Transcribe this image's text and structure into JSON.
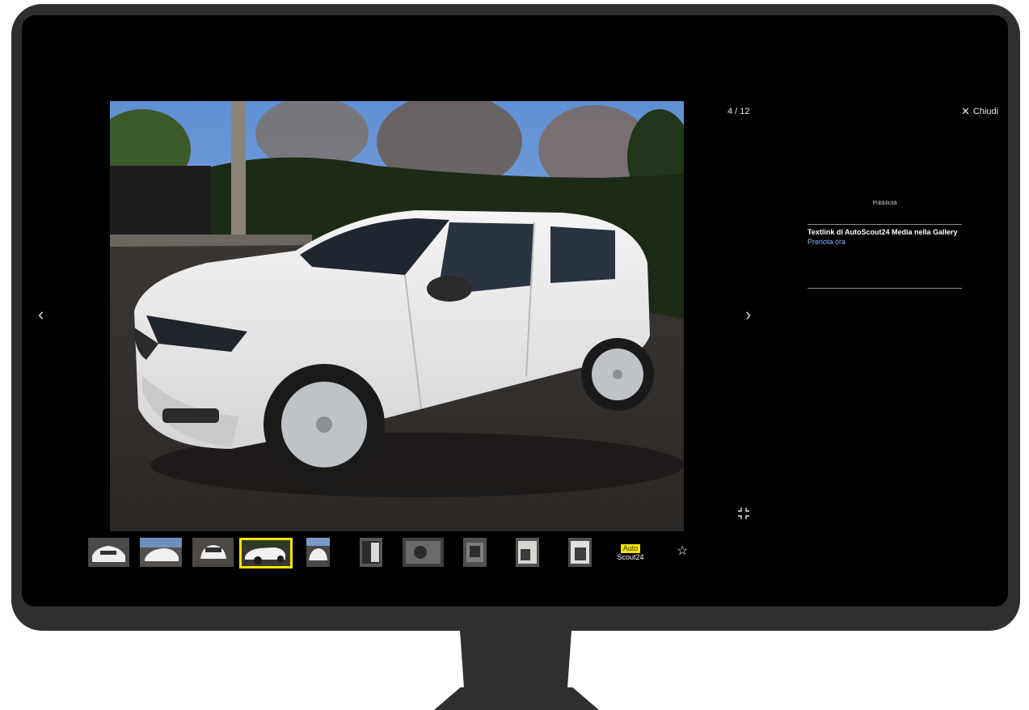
{
  "gallery": {
    "counter": "4 / 12",
    "close_label": "Chiudi",
    "close_icon": "close-icon",
    "prev_icon": "chevron-left-icon",
    "next_icon": "chevron-right-icon",
    "exit_fullscreen_icon": "exit-fullscreen-icon",
    "favorite_icon": "star-outline-icon",
    "active_index": 4
  },
  "ad": {
    "label": "Pubblicità",
    "title": "Textlink di AutoScout24 Media nella Gallery",
    "link": "Prenota ora"
  },
  "logo": {
    "auto": "Auto",
    "scout": "Scout24"
  },
  "colors": {
    "highlight": "#f5e400",
    "link": "#8fb4ff",
    "background": "#000000",
    "bezel": "#2f2f31"
  }
}
